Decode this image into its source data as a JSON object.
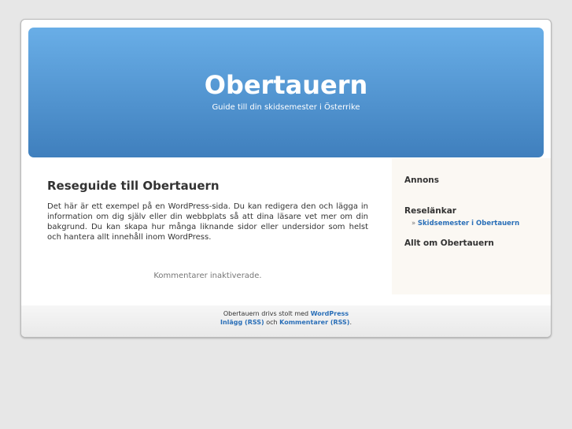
{
  "header": {
    "title": "Obertauern",
    "description": "Guide till din skidsemester i Österrike"
  },
  "post": {
    "title": "Reseguide till Obertauern",
    "body": "Det här är ett exempel på en WordPress-sida. Du kan redigera den och lägga in information om dig själv eller din webbplats så att dina läsare vet mer om din bakgrund. Du kan skapa hur många liknande sidor eller undersidor som helst och hantera allt innehåll inom WordPress.",
    "comments_status": "Kommentarer inaktiverade."
  },
  "sidebar": {
    "widgets": [
      {
        "title": "Annons"
      },
      {
        "title": "Reselänkar",
        "links": [
          {
            "bullet": "»",
            "label": "Skidsemester i Obertauern"
          }
        ]
      },
      {
        "title": "Allt om Obertauern"
      }
    ]
  },
  "footer": {
    "powered_prefix": "Obertauern drivs stolt med",
    "wordpress_link": "WordPress",
    "entries_rss": "Inlägg (RSS)",
    "and_text": "och",
    "comments_rss": "Kommentarer (RSS)",
    "end_punct": "."
  },
  "colors": {
    "header_top": "#69aee7",
    "header_bottom": "#3f7fbd",
    "link": "#2a6fb8",
    "background": "#e7e7e7"
  }
}
